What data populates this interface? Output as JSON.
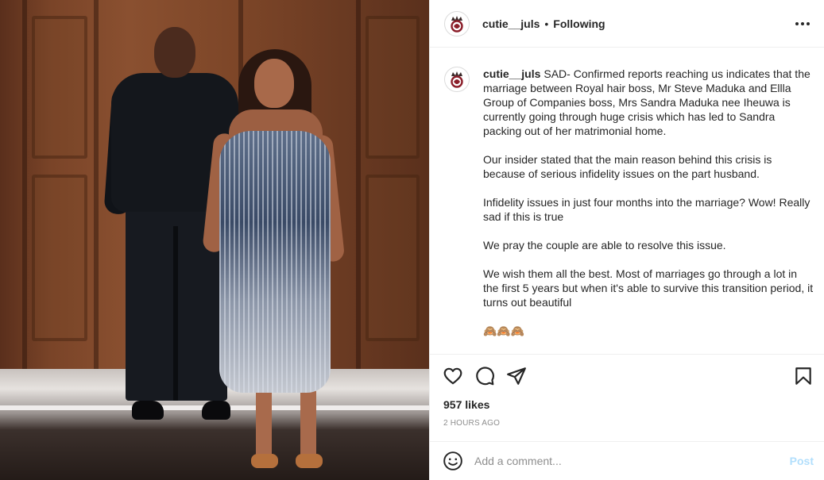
{
  "post": {
    "username": "cutie__juls",
    "separator": "•",
    "follow_status": "Following",
    "caption": {
      "username": "cutie__juls",
      "paragraphs": [
        "SAD- Confirmed reports reaching us indicates that the marriage between Royal hair boss, Mr Steve Maduka and Ellla Group of Companies boss, Mrs Sandra Maduka nee Iheuwa is currently going through huge crisis which has led to Sandra packing out of her matrimonial home.",
        "Our insider stated that the main reason behind this crisis is because of serious infidelity issues on the part husband.",
        "Infidelity issues in just four months into the marriage? Wow! Really sad if this is true",
        "We pray the couple are able to resolve this issue.",
        "We wish them all the best. Most of marriages go through a lot in the first 5 years but when it's able to survive this transition period, it turns out beautiful",
        "🙈🙈🙈"
      ]
    },
    "likes": "957 likes",
    "timestamp": "2 HOURS AGO"
  },
  "comment": {
    "placeholder": "Add a comment...",
    "post_label": "Post"
  },
  "icons": {
    "more": "more-options-icon",
    "like": "heart-icon",
    "comment": "comment-icon",
    "share": "share-icon",
    "save": "bookmark-icon",
    "emoji": "emoji-icon"
  },
  "colors": {
    "text": "#262626",
    "muted": "#8e8e8e",
    "post_button_disabled": "#b2dffc",
    "divider": "#efefef"
  }
}
